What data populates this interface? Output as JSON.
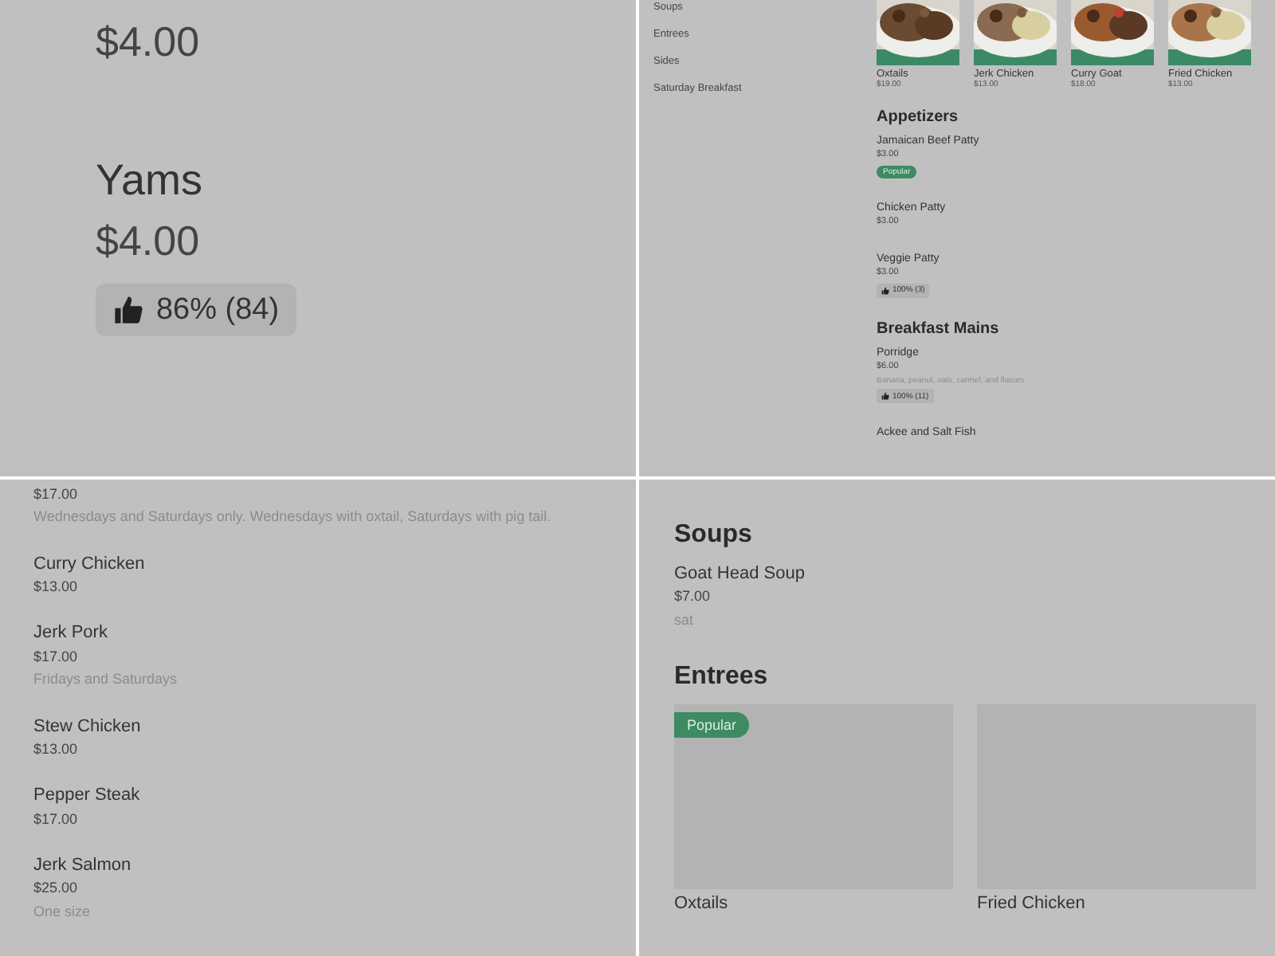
{
  "panels": [
    {
      "kind": "zoom",
      "items": [
        {
          "price": "$4.00"
        },
        {
          "name": "Yams",
          "price": "$4.00",
          "rating": "86% (84)"
        }
      ]
    },
    {
      "kind": "menu",
      "sidebar": [
        {
          "label": "Soups"
        },
        {
          "label": "Entrees"
        },
        {
          "label": "Sides"
        },
        {
          "label": "Saturday Breakfast"
        }
      ],
      "featured": [
        {
          "name": "Oxtails",
          "price": "$19.00"
        },
        {
          "name": "Jerk Chicken",
          "price": "$13.00"
        },
        {
          "name": "Curry Goat",
          "price": "$18.00"
        },
        {
          "name": "Fried Chicken",
          "price": "$13.00"
        }
      ],
      "sections": [
        {
          "title": "Appetizers",
          "items": [
            {
              "name": "Jamaican Beef Patty",
              "price": "$3.00",
              "badge": "Popular"
            },
            {
              "name": "Chicken Patty",
              "price": "$3.00"
            },
            {
              "name": "Veggie Patty",
              "price": "$3.00",
              "rating": "100% (3)"
            }
          ]
        },
        {
          "title": "Breakfast Mains",
          "items": [
            {
              "name": "Porridge",
              "price": "$6.00",
              "note": "Banana, peanut, oats, carmel, and flavors",
              "rating": "100% (11)"
            },
            {
              "name": "Ackee and Salt Fish"
            }
          ]
        }
      ]
    },
    {
      "kind": "list",
      "items": [
        {
          "price": "$17.00",
          "note": "Wednesdays and Saturdays only. Wednesdays with oxtail, Saturdays with pig tail."
        },
        {
          "name": "Curry Chicken",
          "price": "$13.00"
        },
        {
          "name": "Jerk Pork",
          "price": "$17.00",
          "note": "Fridays and Saturdays"
        },
        {
          "name": "Stew Chicken",
          "price": "$13.00"
        },
        {
          "name": "Pepper Steak",
          "price": "$17.00"
        },
        {
          "name": "Jerk Salmon",
          "price": "$25.00",
          "note": "One size"
        }
      ]
    },
    {
      "kind": "sections",
      "sections": [
        {
          "title": "Soups",
          "items": [
            {
              "name": "Goat Head Soup",
              "price": "$7.00",
              "note": "sat"
            }
          ]
        },
        {
          "title": "Entrees",
          "cards": [
            {
              "name": "Oxtails",
              "badge": "Popular"
            },
            {
              "name": "Fried Chicken"
            }
          ]
        }
      ]
    }
  ]
}
